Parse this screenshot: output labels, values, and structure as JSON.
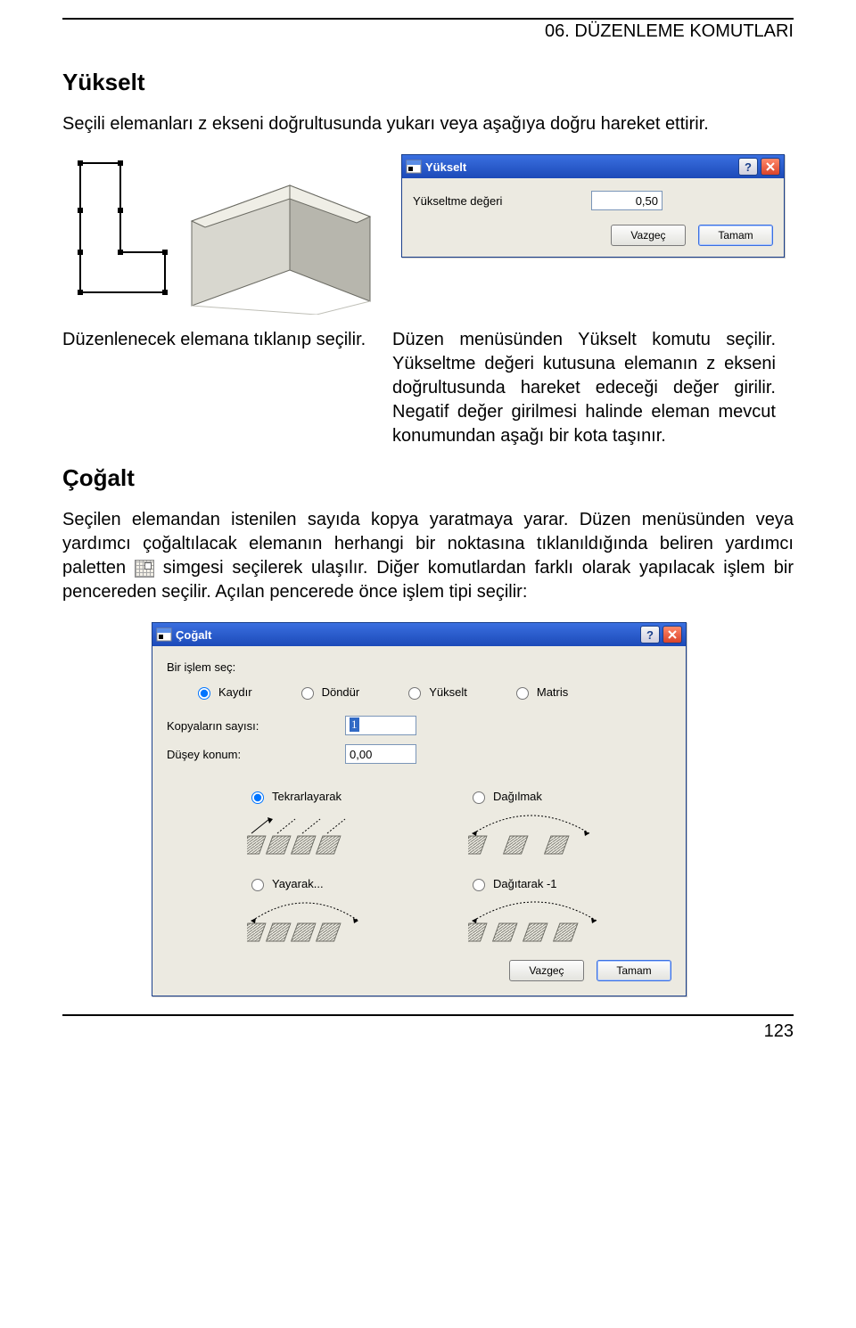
{
  "page": {
    "header": "06. DÜZENLEME KOMUTLARI",
    "page_number": "123"
  },
  "sec_yukselt": {
    "title": "Yükselt",
    "intro": "Seçili elemanları z ekseni doğrultusunda yukarı veya aşağıya doğru hareket ettirir.",
    "caption_left": "Düzenlenecek elemana tıklanıp seçilir.",
    "caption_right": "Düzen menüsünden Yükselt komutu seçilir. Yükseltme değeri kutusuna elemanın z ekseni doğrultusunda hareket edeceği değer girilir. Negatif değer girilmesi halinde eleman mevcut konumundan aşağı bir kota taşınır."
  },
  "dlg_yukselt": {
    "title": "Yükselt",
    "label": "Yükseltme değeri",
    "value": "0,50",
    "btn_cancel": "Vazgeç",
    "btn_ok": "Tamam"
  },
  "sec_cogalt": {
    "title": "Çoğalt",
    "para_a": "Seçilen elemandan istenilen sayıda kopya yaratmaya yarar. Düzen menüsünden veya yardımcı çoğaltılacak elemanın herhangi bir noktasına tıklanıldığında beliren yardımcı paletten ",
    "para_b": " simgesi seçilerek ulaşılır. Diğer komutlardan farklı olarak yapılacak işlem bir pencereden seçilir. Açılan pencerede önce işlem tipi seçilir:"
  },
  "dlg_cogalt": {
    "title": "Çoğalt",
    "grp1_label": "Bir işlem seç:",
    "ops": {
      "kaydir": "Kaydır",
      "dondur": "Döndür",
      "yukselt": "Yükselt",
      "matris": "Matris"
    },
    "copies_label": "Kopyaların sayısı:",
    "copies_value": "1",
    "dusey_label": "Düşey konum:",
    "dusey_value": "0,00",
    "modes": {
      "tekrar": "Tekrarlayarak",
      "dagilmak": "Dağılmak",
      "yayarak": "Yayarak...",
      "dagitarak": "Dağıtarak -1"
    },
    "btn_cancel": "Vazgeç",
    "btn_ok": "Tamam"
  }
}
